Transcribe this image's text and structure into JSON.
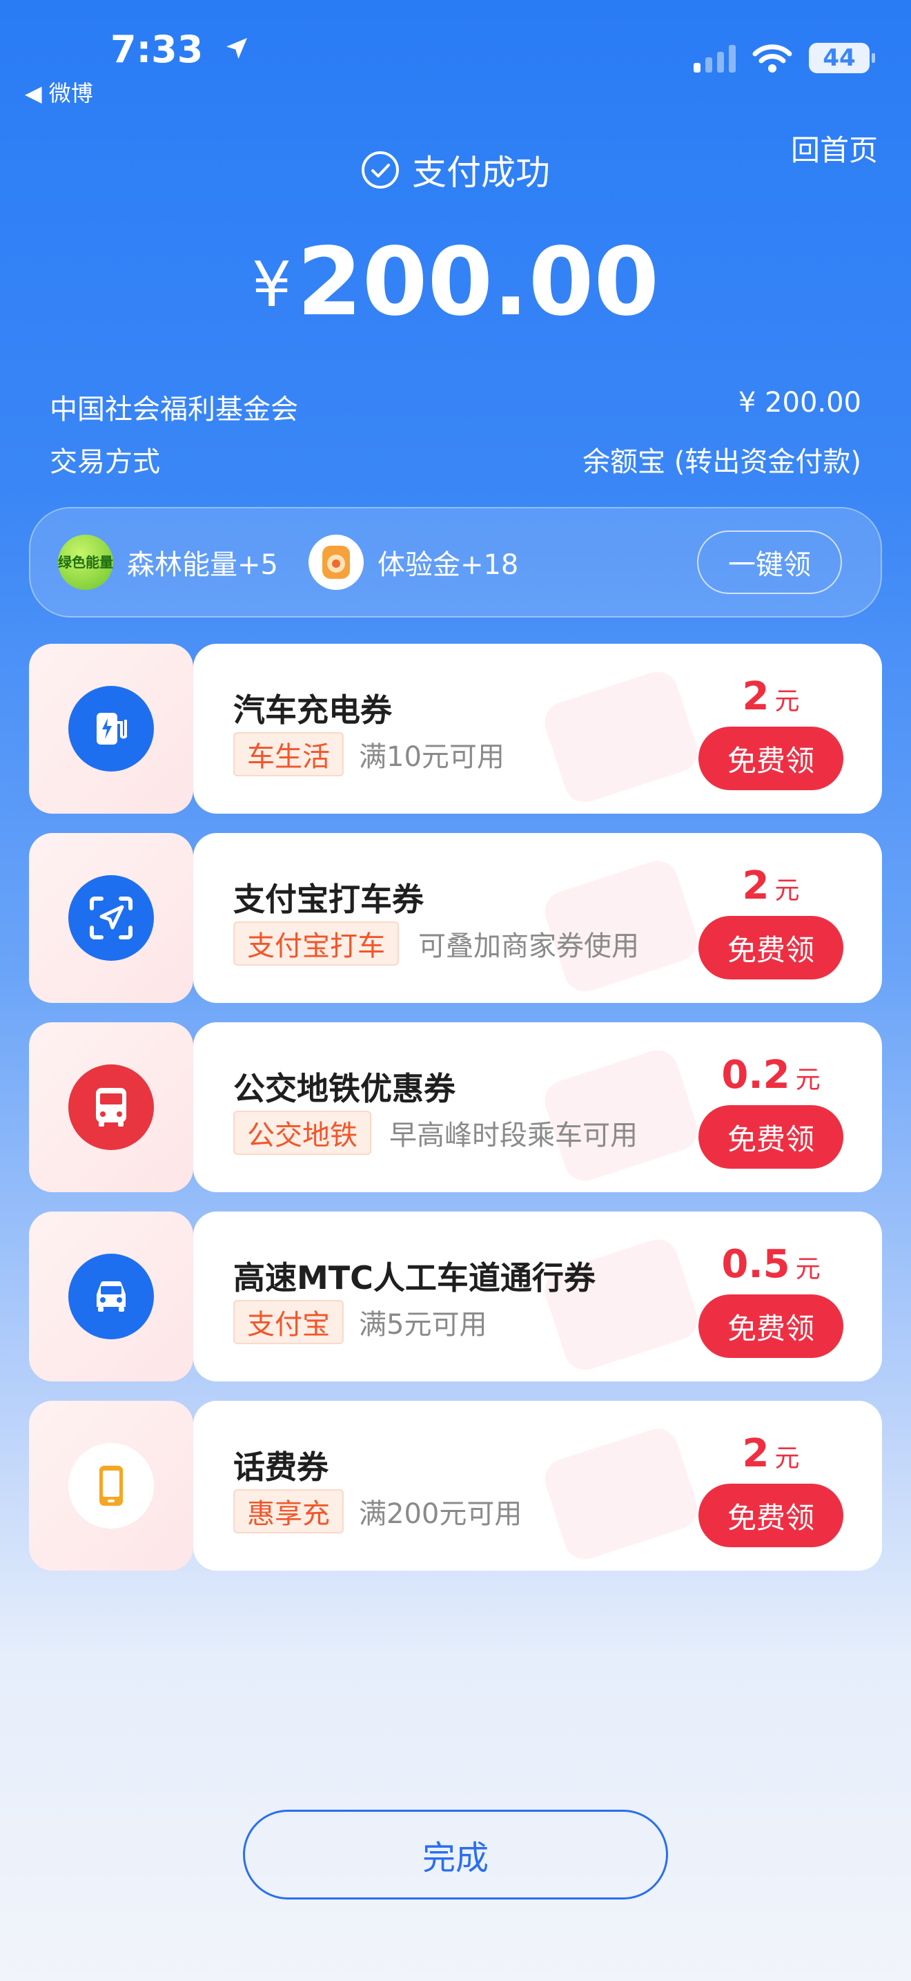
{
  "status_bar": {
    "time": "7:33",
    "back_app": "◀ 微博",
    "battery": "44"
  },
  "header": {
    "home_link": "回首页",
    "success_text": "支付成功",
    "currency": "¥",
    "amount": "200.00"
  },
  "details": [
    {
      "label": "中国社会福利基金会",
      "value": "¥ 200.00"
    },
    {
      "label": "交易方式",
      "value": "余额宝 (转出资金付款)"
    }
  ],
  "rewards": {
    "green_badge": "绿色能量",
    "items": [
      {
        "label": "森林能量+5",
        "icon": "green-energy-icon"
      },
      {
        "label": "体验金+18",
        "icon": "gold-coin-icon"
      }
    ],
    "claim_all": "一键领"
  },
  "coupons": [
    {
      "title": "汽车充电券",
      "tag": "车生活",
      "condition": "满10元可用",
      "value": "2",
      "unit": "元",
      "button": "免费领",
      "icon": "ev-charging-icon",
      "icon_color": "#1e6ff0"
    },
    {
      "title": "支付宝打车券",
      "tag": "支付宝打车",
      "condition": "可叠加商家券使用",
      "value": "2",
      "unit": "元",
      "button": "免费领",
      "icon": "navigation-arrow-icon",
      "icon_color": "#1e6ff0"
    },
    {
      "title": "公交地铁优惠券",
      "tag": "公交地铁",
      "condition": "早高峰时段乘车可用",
      "value": "0.2",
      "unit": "元",
      "button": "免费领",
      "icon": "bus-icon",
      "icon_color": "#e8353f"
    },
    {
      "title": "高速MTC人工车道通行券",
      "tag": "支付宝",
      "condition": "满5元可用",
      "value": "0.5",
      "unit": "元",
      "button": "免费领",
      "icon": "car-icon",
      "icon_color": "#1e6ff0"
    },
    {
      "title": "话费券",
      "tag": "惠享充",
      "condition": "满200元可用",
      "value": "2",
      "unit": "元",
      "button": "免费领",
      "icon": "phone-icon",
      "icon_color": "#f5a623"
    }
  ],
  "done_button": "完成"
}
